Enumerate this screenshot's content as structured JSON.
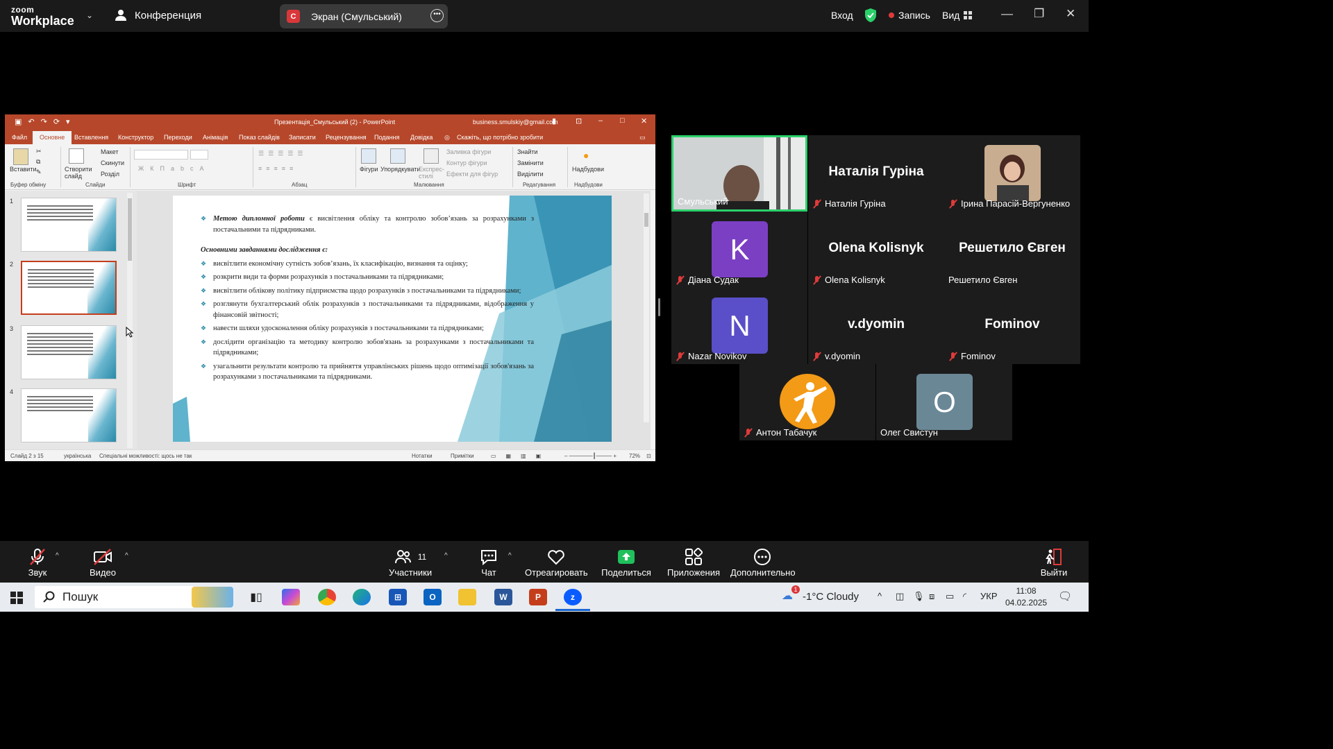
{
  "zoom": {
    "logo_small": "zoom",
    "logo_big": "Workplace",
    "meeting_label": "Конференция",
    "share_label": "Экран (Смульський)",
    "share_badge": "С",
    "signin": "Вход",
    "record": "Запись",
    "view": "Вид",
    "record_color": "#e03a3a",
    "shield_color": "#2ad16a"
  },
  "ppt": {
    "title": "Презентація_Смульський (2) - PowerPoint",
    "account": "business.smulskiy@gmail.com",
    "tabs": [
      "Файл",
      "Основне",
      "Вставлення",
      "Конструктор",
      "Переходи",
      "Анімація",
      "Показ слайдів",
      "Записати",
      "Рецензування",
      "Подання",
      "Довідка"
    ],
    "tell_me": "Скажіть, що потрібно зробити",
    "ribbon": {
      "paste": "Вставити",
      "clipboard": "Буфер обміну",
      "new_slide": "Створити слайд",
      "layout": "Макет",
      "reset": "Скинути",
      "section": "Розділ",
      "slides": "Слайди",
      "font": "Шрифт",
      "paragraph": "Абзац",
      "shapes": "Фігури",
      "arrange": "Упорядкувати",
      "quick_styles": "Експрес-стилі",
      "shape_fill": "Заливка фігури",
      "shape_outline": "Контур фігури",
      "shape_effects": "Ефекти для фігур",
      "drawing": "Малювання",
      "find": "Знайти",
      "replace": "Замінити",
      "select": "Виділити",
      "editing": "Редагування",
      "addins": "Надбудови",
      "addins_group": "Надбудови"
    },
    "thumb_numbers": [
      "1",
      "2",
      "3",
      "4"
    ],
    "slide": {
      "b1_italic": "Метою дипломної роботи",
      "b1_rest": " є висвітлення обліку та контролю зобов’язань за розрахунками з постачальними та підрядниками.",
      "heading": "Основними завданнями дослідження є:",
      "bullets": [
        "висвітлити економічну сутність зобов’язань, їх класифікацію, визнання та оцінку;",
        "розкрити види та форми  розрахунків з постачальниками та підрядниками;",
        "висвітлити облікову політику підприємства щодо розрахунків з постачальниками та підрядниками;",
        "розглянути бухгалтерський облік розрахунків з постачальниками та підрядниками, відображення у фінансовій звітності;",
        "навести шляхи удосконалення обліку розрахунків з постачальниками та підрядниками;",
        "дослідити організацію та методику контролю зобов'язань за розрахунками з постачальниками та підрядниками;",
        "узагальнити результати контролю та прийняття управлінських рішень щодо оптимізації зобов'язань за розрахунками з постачальниками та підрядниками."
      ]
    },
    "status": {
      "slide_of": "Слайд 2 з 15",
      "lang": "українська",
      "access": "Спеціальні можливості: щось не так",
      "notes": "Нотатки",
      "comments": "Примітки",
      "zoom": "72%"
    }
  },
  "participants": [
    {
      "name": "Смульський",
      "type": "video",
      "muted": false,
      "active": true
    },
    {
      "name": "Наталія Гуріна",
      "type": "name",
      "big": "Наталія Гуріна",
      "muted": true
    },
    {
      "name": "Ірина Парасій-Вергуненко",
      "type": "photo",
      "muted": true
    },
    {
      "name": "Діана Судак",
      "type": "avatar",
      "letter": "K",
      "color": "#7b3fc4",
      "muted": true
    },
    {
      "name": "Olena Kolisnyk",
      "type": "name",
      "big": "Olena Kolisnyk",
      "muted": true
    },
    {
      "name": "Решетило Євген",
      "type": "name",
      "big": "Решетило Євген",
      "muted": false
    },
    {
      "name": "Nazar Novikov",
      "type": "avatar",
      "letter": "N",
      "color": "#5a4fc8",
      "muted": true
    },
    {
      "name": "v.dyomin",
      "type": "name",
      "big": "v.dyomin",
      "muted": true
    },
    {
      "name": "Fominov",
      "type": "name",
      "big": "Fominov",
      "muted": true
    },
    {
      "name": "Антон Табачук",
      "type": "logo",
      "muted": true
    },
    {
      "name": "Олег Свистун",
      "type": "avatar",
      "letter": "О",
      "color": "#6a8796",
      "muted": false
    }
  ],
  "toolbar": {
    "audio": "Звук",
    "video": "Видео",
    "participants": "Участники",
    "participants_count": "11",
    "chat": "Чат",
    "react": "Отреагировать",
    "share": "Поделиться",
    "apps": "Приложения",
    "more": "Дополнительно",
    "leave": "Выйти"
  },
  "taskbar": {
    "search": "Пошук",
    "weather": "-1°C  Cloudy",
    "weather_badge": "1",
    "lang": "УКР",
    "time": "11:08",
    "date": "04.02.2025"
  }
}
